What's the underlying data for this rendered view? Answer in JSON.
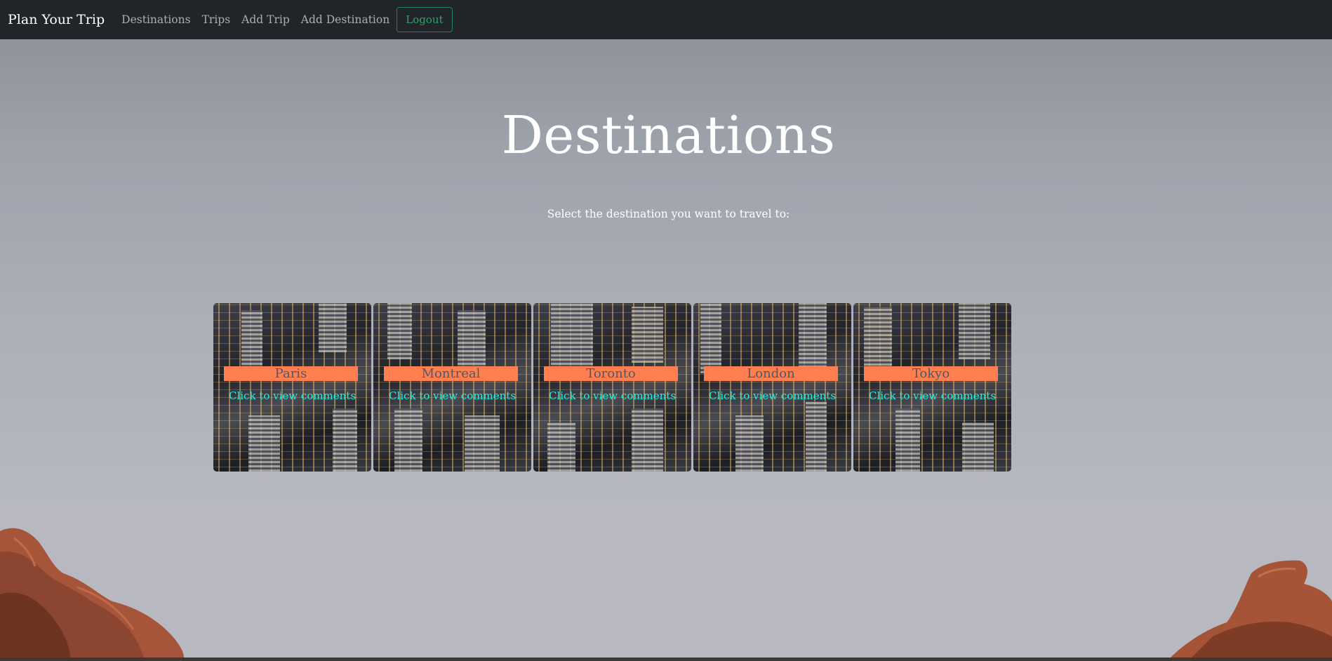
{
  "navbar": {
    "brand": "Plan Your Trip",
    "links": [
      "Destinations",
      "Trips",
      "Add Trip",
      "Add Destination"
    ],
    "logout_label": "Logout"
  },
  "hero": {
    "title": "Destinations",
    "subtitle": "Select the destination you want to travel to:"
  },
  "destinations": [
    {
      "name": "Paris",
      "link": "Click to view comments"
    },
    {
      "name": "Montreal",
      "link": "Click to view comments"
    },
    {
      "name": "Toronto",
      "link": "Click to view comments"
    },
    {
      "name": "London",
      "link": "Click to view comments"
    },
    {
      "name": "Tokyo",
      "link": "Click to view comments"
    }
  ],
  "colors": {
    "navbar_bg": "#212529",
    "label_bg": "#ff7f50",
    "link_color": "#1ff0ea",
    "logout_color": "#198754"
  }
}
